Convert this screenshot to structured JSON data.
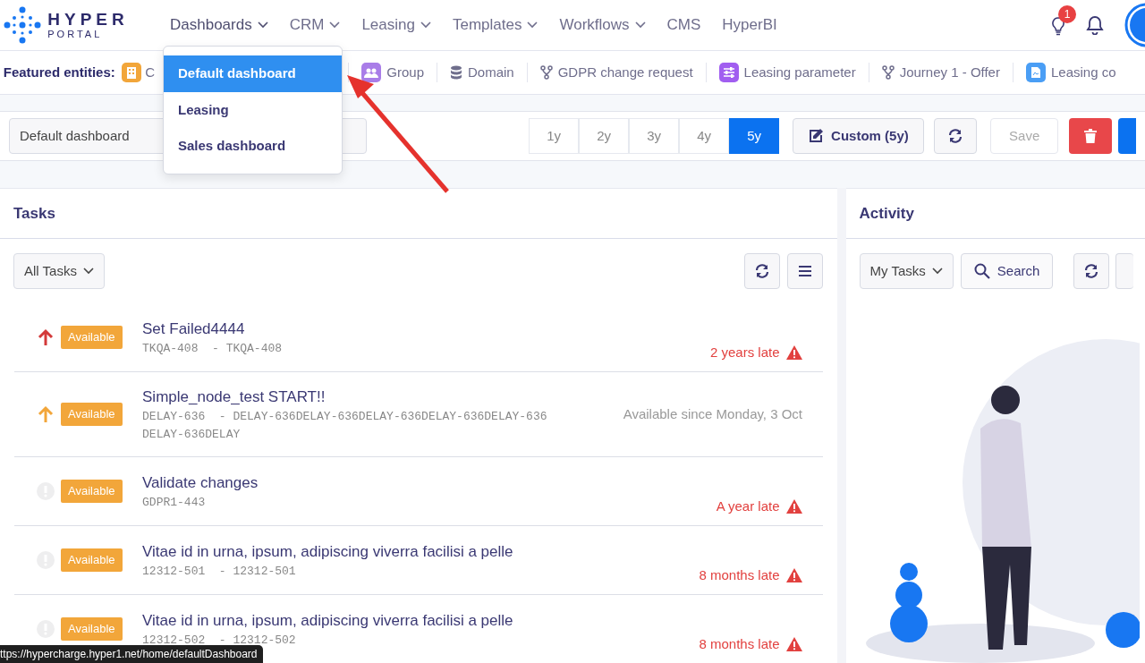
{
  "logo": {
    "word1": "HYPER",
    "word2": "PORTAL"
  },
  "nav": [
    {
      "label": "Dashboards",
      "dropdown": true,
      "open": true
    },
    {
      "label": "CRM",
      "dropdown": true,
      "open": false
    },
    {
      "label": "Leasing",
      "dropdown": true,
      "open": false
    },
    {
      "label": "Templates",
      "dropdown": true,
      "open": false
    },
    {
      "label": "Workflows",
      "dropdown": true,
      "open": false
    },
    {
      "label": "CMS",
      "dropdown": false,
      "open": false
    },
    {
      "label": "HyperBI",
      "dropdown": false,
      "open": false
    }
  ],
  "notification_badge": "1",
  "dashboards_menu": [
    {
      "label": "Default dashboard",
      "selected": true
    },
    {
      "label": "Leasing",
      "selected": false
    },
    {
      "label": "Sales dashboard",
      "selected": false
    }
  ],
  "featured": {
    "label": "Featured entities:",
    "entities": [
      {
        "label": "C",
        "kind": "building"
      },
      {
        "label": "Group",
        "kind": "group"
      },
      {
        "label": "Domain",
        "kind": "database"
      },
      {
        "label": "GDPR change request",
        "kind": "fork"
      },
      {
        "label": "Leasing parameter",
        "kind": "sliders"
      },
      {
        "label": "Journey 1 - Offer",
        "kind": "fork"
      },
      {
        "label": "Leasing co",
        "kind": "document"
      }
    ]
  },
  "toolbar": {
    "dashboard": "Default dashboard",
    "periods": [
      {
        "label": "1y",
        "selected": false
      },
      {
        "label": "2y",
        "selected": false
      },
      {
        "label": "3y",
        "selected": false
      },
      {
        "label": "4y",
        "selected": false
      },
      {
        "label": "5y",
        "selected": true
      }
    ],
    "custom": "Custom (5y)",
    "save": {
      "label": "Save",
      "disabled": true
    }
  },
  "tasks": {
    "title": "Tasks",
    "filter": "All Tasks",
    "rows": [
      {
        "kind": "high",
        "status": "Available",
        "title": "Set Failed4444",
        "ref": "TKQA-408  - TKQA-408",
        "due": "2 years late",
        "overdue": true
      },
      {
        "kind": "medium",
        "status": "Available",
        "title": "Simple_node_test START!!",
        "ref": "DELAY-636  - DELAY-636DELAY-636DELAY-636DELAY-636DELAY-636DELAY-636DELAY",
        "due": "Available since Monday, 3 Oct",
        "overdue": false
      },
      {
        "kind": "none",
        "status": "Available",
        "title": "Validate changes",
        "ref": "GDPR1-443",
        "due": "A year late",
        "overdue": true
      },
      {
        "kind": "none",
        "status": "Available",
        "title": "Vitae id in urna, ipsum, adipiscing viverra facilisi a pelle",
        "ref": "12312-501  - 12312-501",
        "due": "8 months late",
        "overdue": true
      },
      {
        "kind": "none",
        "status": "Available",
        "title": "Vitae id in urna, ipsum, adipiscing viverra facilisi a pelle",
        "ref": "12312-502  - 12312-502",
        "due": "8 months late",
        "overdue": true
      }
    ]
  },
  "activity": {
    "title": "Activity",
    "filter": "My Tasks",
    "search": "Search"
  },
  "status_url": "ttps://hypercharge.hyper1.net/home/defaultDashboard"
}
